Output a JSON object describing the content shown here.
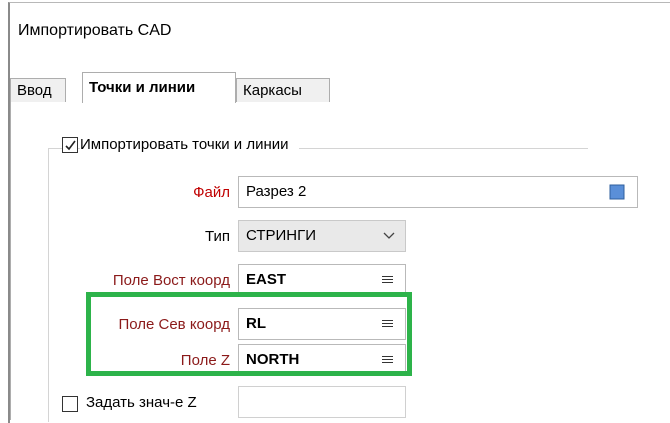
{
  "window": {
    "title": "Импортировать CAD"
  },
  "tabs": [
    {
      "label": "Ввод"
    },
    {
      "label": "Точки и линии"
    },
    {
      "label": "Каркасы"
    }
  ],
  "group": {
    "checkbox_label": "Импортировать точки и линии",
    "checked": true
  },
  "fields": {
    "file": {
      "label": "Файл",
      "value": "Разрез 2"
    },
    "type": {
      "label": "Тип",
      "value": "СТРИНГИ"
    },
    "east": {
      "label": "Поле Вост коорд",
      "value": "EAST"
    },
    "north": {
      "label": "Поле Сев коорд",
      "value": "RL"
    },
    "z": {
      "label": "Поле Z",
      "value": "NORTH"
    }
  },
  "z_value": {
    "checkbox_label": "Задать знач-е Z",
    "checked": false,
    "value": ""
  },
  "colors": {
    "highlight": "#2db34a",
    "required_label": "#c00000",
    "label_dark": "#8b1a1a"
  }
}
